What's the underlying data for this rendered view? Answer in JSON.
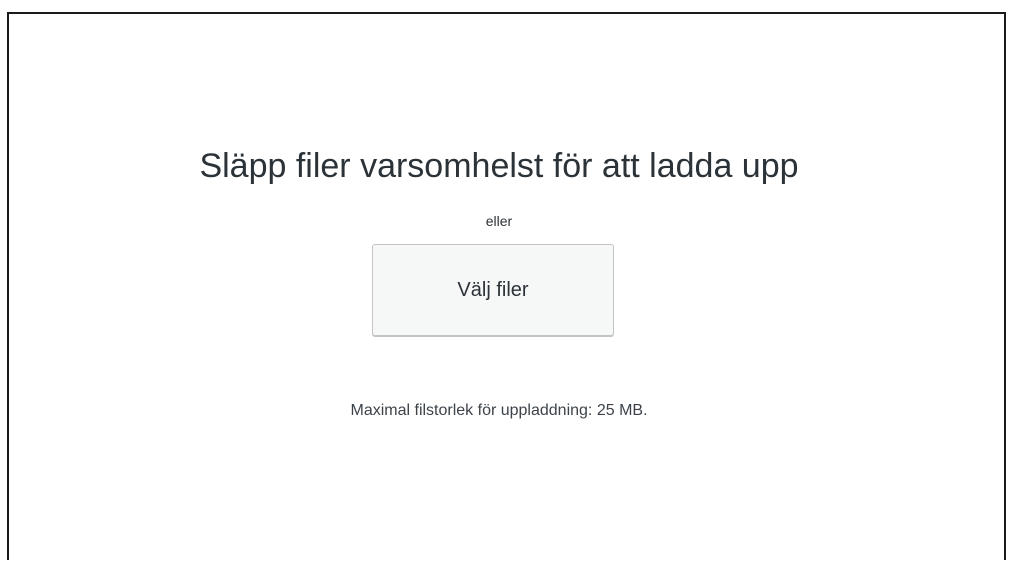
{
  "uploader": {
    "title": "Släpp filer varsomhelst för att ladda upp",
    "or_text": "eller",
    "select_button_label": "Välj filer",
    "max_upload_size": "Maximal filstorlek för uppladdning: 25 MB."
  }
}
